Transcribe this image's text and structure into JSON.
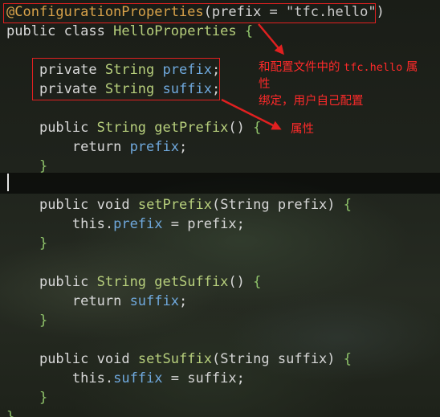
{
  "editor": {
    "line1": {
      "annotation": "@ConfigurationProperties",
      "open_paren": "(",
      "param": "prefix",
      "eq": " = ",
      "value": "\"tfc.hello\"",
      "close_paren": ")"
    },
    "line2": {
      "kw1": "public",
      "kw2": "class",
      "name": "HelloProperties",
      "brace": "{"
    },
    "line3": {
      "kw": "private",
      "type": "String",
      "field": "prefix",
      "semi": ";"
    },
    "line4": {
      "kw": "private",
      "type": "String",
      "field": "suffix",
      "semi": ";"
    },
    "line5": {
      "kw": "public",
      "type": "String",
      "method": "getPrefix",
      "parens": "()",
      "brace": "{"
    },
    "line6": {
      "kw": "return",
      "field": "prefix",
      "semi": ";"
    },
    "line7": {
      "brace": "}"
    },
    "line8": {
      "kw1": "public",
      "kw2": "void",
      "method": "setPrefix",
      "open": "(",
      "ptype": "String",
      "pname": "prefix",
      "close": ")",
      "brace": "{"
    },
    "line9": {
      "this": "this",
      "dot": ".",
      "field": "prefix",
      "rest": " = prefix;"
    },
    "line10": {
      "brace": "}"
    },
    "line11": {
      "kw": "public",
      "type": "String",
      "method": "getSuffix",
      "parens": "()",
      "brace": "{"
    },
    "line12": {
      "kw": "return",
      "field": "suffix",
      "semi": ";"
    },
    "line13": {
      "brace": "}"
    },
    "line14": {
      "kw1": "public",
      "kw2": "void",
      "method": "setSuffix",
      "open": "(",
      "ptype": "String",
      "pname": "suffix",
      "close": ")",
      "brace": "{"
    },
    "line15": {
      "this": "this",
      "dot": ".",
      "field": "suffix",
      "rest": " = suffix;"
    },
    "line16": {
      "brace": "}"
    },
    "line17": {
      "brace": "}"
    }
  },
  "annotations": {
    "note1": {
      "part1": "和配置文件中的 ",
      "code": "tfc.hello",
      "part2": " 属",
      "line2": "性",
      "line3": "绑定，用户自己配置"
    },
    "note2": "属性"
  },
  "colors": {
    "annotation_box": "#e02020",
    "note_text": "#ff2a2a",
    "type": "#b7cf7c",
    "field": "#6fa8dc",
    "annotation": "#d8a24a"
  }
}
